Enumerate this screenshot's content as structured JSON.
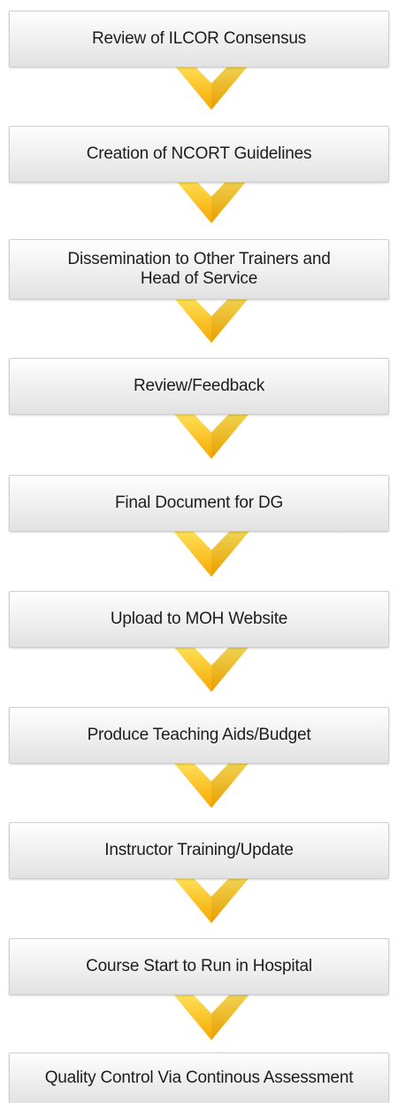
{
  "steps": [
    {
      "label": "Review of ILCOR Consensus"
    },
    {
      "label": "Creation of NCORT Guidelines"
    },
    {
      "label": "Dissemination to Other Trainers and\nHead of Service"
    },
    {
      "label": "Review/Feedback"
    },
    {
      "label": "Final Document for DG"
    },
    {
      "label": "Upload to MOH Website"
    },
    {
      "label": "Produce Teaching Aids/Budget"
    },
    {
      "label": "Instructor Training/Update"
    },
    {
      "label": "Course Start to Run in Hospital"
    },
    {
      "label": "Quality Control Via Continous Assessment"
    }
  ],
  "colors": {
    "arrow_light": "#ffe45c",
    "arrow_dark": "#f7a800",
    "box_top": "#fefefe",
    "box_bottom": "#e2e2e2",
    "text": "#1d1d1d"
  }
}
